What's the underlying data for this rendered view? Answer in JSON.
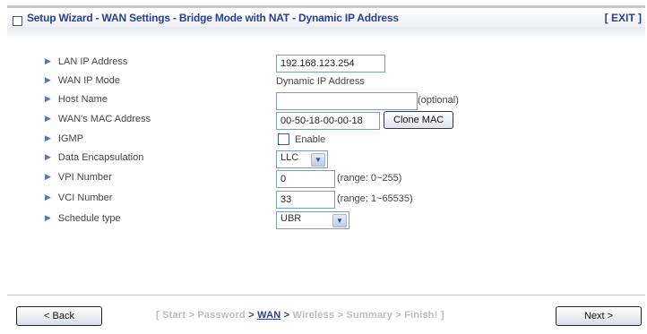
{
  "header": {
    "title": "Setup Wizard - WAN Settings - Bridge Mode with NAT - Dynamic IP Address",
    "exit_label": "[ EXIT ]"
  },
  "form": {
    "lan_ip": {
      "label": "LAN IP Address",
      "value": "192.168.123.254"
    },
    "wan_ip_mode": {
      "label": "WAN IP Mode",
      "value": "Dynamic IP Address"
    },
    "host_name": {
      "label": "Host Name",
      "value": "",
      "note": "(optional)"
    },
    "wan_mac": {
      "label": "WAN's MAC Address",
      "value": "00-50-18-00-00-18",
      "button": "Clone MAC"
    },
    "igmp": {
      "label": "IGMP",
      "checkbox_label": "Enable",
      "checked": false
    },
    "data_encap": {
      "label": "Data Encapsulation",
      "selected": "LLC"
    },
    "vpi": {
      "label": "VPI Number",
      "value": "0",
      "range": "(range: 0~255)"
    },
    "vci": {
      "label": "VCI Number",
      "value": "33",
      "range": "(range: 1~65535)"
    },
    "schedule": {
      "label": "Schedule type",
      "selected": "UBR"
    }
  },
  "footer": {
    "back_label": "< Back",
    "next_label": "Next >",
    "steps": {
      "open": "[",
      "start": "Start",
      "password": "Password",
      "wan": "WAN",
      "wireless": "Wireless",
      "summary": "Summary",
      "finish": "Finish!",
      "close": "]",
      "separator": ">"
    }
  },
  "icons": {
    "title_box": "square-icon",
    "bullet": "triangle-right-icon",
    "dropdown": "chevron-down-icon"
  },
  "colors": {
    "title": "#2a3f8e",
    "current_step": "#2a3f8e",
    "inactive_step": "#bdbdbd"
  }
}
